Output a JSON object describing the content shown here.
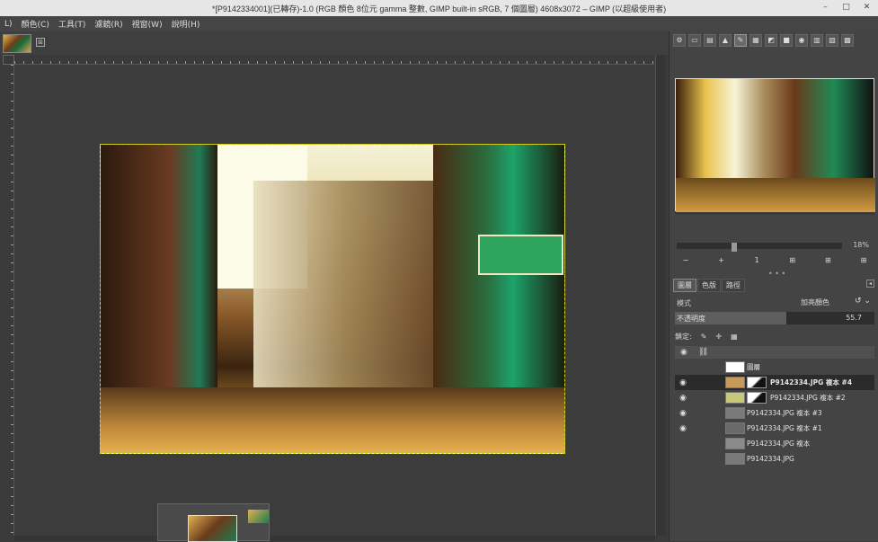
{
  "titlebar": {
    "title": "*[P9142334001](已轉存)-1.0 (RGB 顏色 8位元 gamma 整數, GIMP built-in sRGB, 7 個圖層) 4608x3072 – GIMP (以超級使用者)",
    "min": "–",
    "max": "□",
    "close": "✕"
  },
  "menu": [
    "L)",
    "顏色(C)",
    "工具(T)",
    "濾鏡(R)",
    "視窗(W)",
    "說明(H)"
  ],
  "image_tab": {
    "close_glyph": "⊠"
  },
  "navigator": {
    "zoom": "18%",
    "buttons": [
      "−",
      "+",
      "1",
      "⊞",
      "⊞",
      "⊞"
    ],
    "grip": "• • •"
  },
  "layers_panel": {
    "tabs": [
      "圖層",
      "色版",
      "路徑"
    ],
    "mode_label": "模式",
    "mode_value": "加亮顏色",
    "opacity_label": "不透明度",
    "opacity_value": "55.7",
    "opacity_fraction": 0.557,
    "lock_label": "鎖定:",
    "layers": [
      {
        "name": "圖層",
        "visible": false,
        "selected": false,
        "thumb": "#ffffff",
        "mask": false
      },
      {
        "name": "P9142334.JPG 複本 #4",
        "visible": true,
        "selected": true,
        "thumb": "#c89a5a",
        "mask": true
      },
      {
        "name": "P9142334.JPG 複本 #2",
        "visible": true,
        "selected": false,
        "thumb": "#c8c87a",
        "mask": true
      },
      {
        "name": "P9142334.JPG 複本 #3",
        "visible": true,
        "selected": false,
        "thumb": "#7a7a7a",
        "mask": false
      },
      {
        "name": "P9142334.JPG 複本 #1",
        "visible": true,
        "selected": false,
        "thumb": "#6a6a6a",
        "mask": false
      },
      {
        "name": "P9142334.JPG 複本",
        "visible": false,
        "selected": false,
        "thumb": "#8a8a8a",
        "mask": false
      },
      {
        "name": "P9142334.JPG",
        "visible": false,
        "selected": false,
        "thumb": "#7a7a7a",
        "mask": false
      }
    ]
  }
}
